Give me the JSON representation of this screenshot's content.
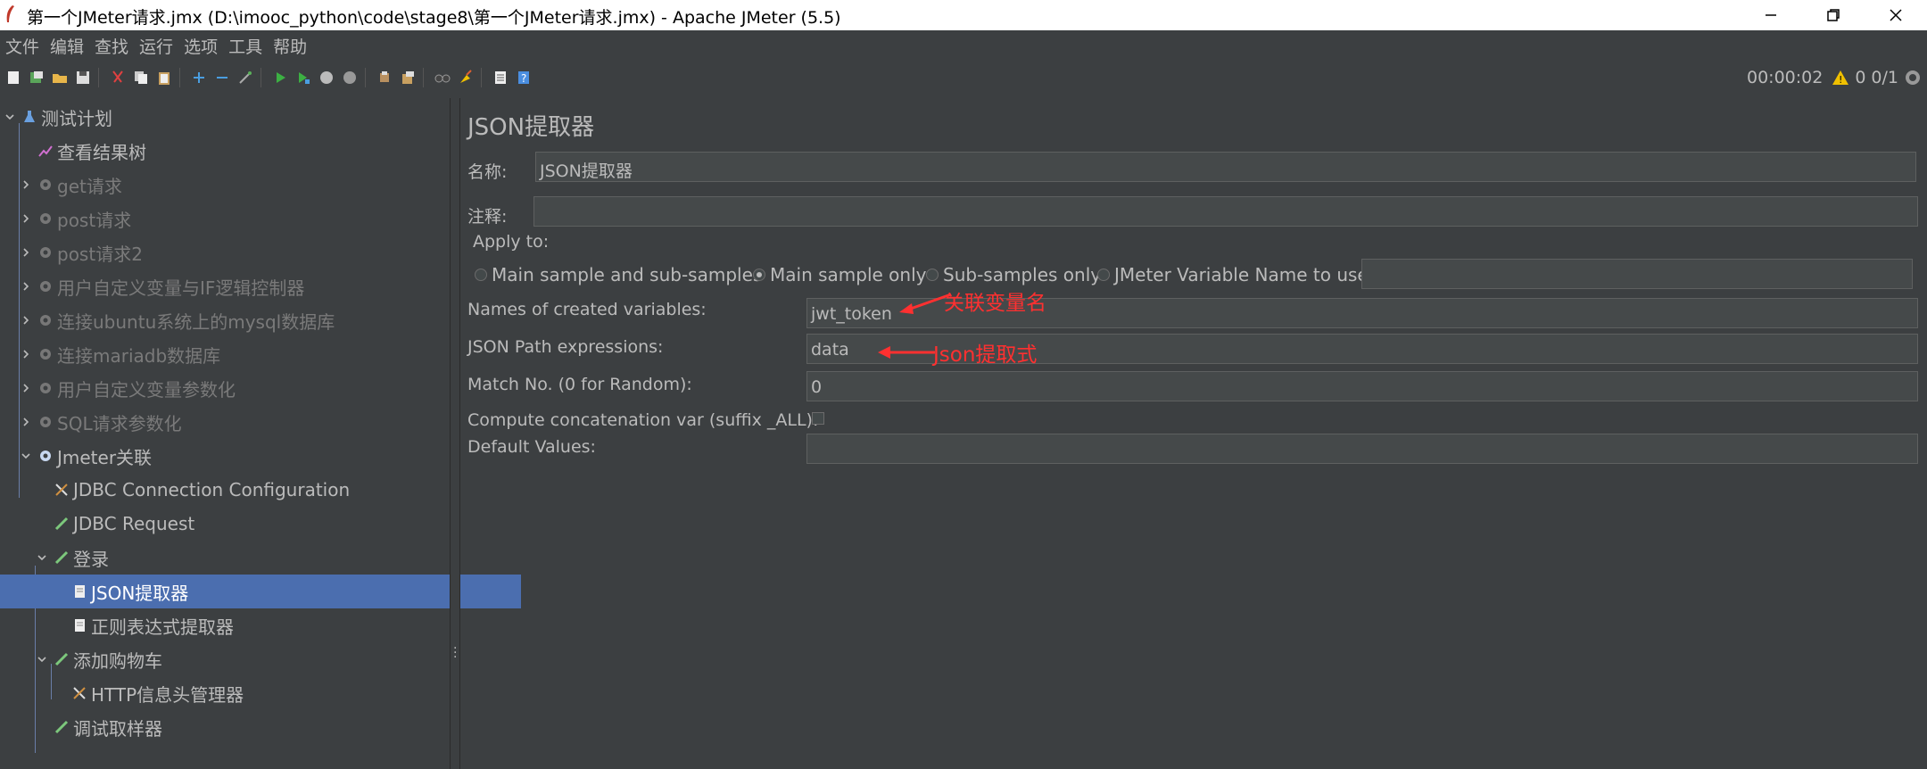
{
  "window": {
    "title": "第一个JMeter请求.jmx (D:\\imooc_python\\code\\stage8\\第一个JMeter请求.jmx) - Apache JMeter (5.5)"
  },
  "menu": [
    "文件",
    "编辑",
    "查找",
    "运行",
    "选项",
    "工具",
    "帮助"
  ],
  "status": {
    "elapsed": "00:00:02",
    "warnings": "0",
    "threads": "0/1"
  },
  "tree": [
    {
      "label": "测试计划",
      "icon": "test-plan-icon"
    },
    {
      "label": "查看结果树",
      "icon": "results-tree-icon"
    },
    {
      "label": "get请求",
      "icon": "thread-group-icon",
      "disabled": true
    },
    {
      "label": "post请求",
      "icon": "thread-group-icon",
      "disabled": true
    },
    {
      "label": "post请求2",
      "icon": "thread-group-icon",
      "disabled": true
    },
    {
      "label": "用户自定义变量与IF逻辑控制器",
      "icon": "thread-group-icon",
      "disabled": true
    },
    {
      "label": "连接ubuntu系统上的mysql数据库",
      "icon": "thread-group-icon",
      "disabled": true
    },
    {
      "label": "连接mariadb数据库",
      "icon": "thread-group-icon",
      "disabled": true
    },
    {
      "label": "用户自定义变量参数化",
      "icon": "thread-group-icon",
      "disabled": true
    },
    {
      "label": "SQL请求参数化",
      "icon": "thread-group-icon",
      "disabled": true
    },
    {
      "label": "Jmeter关联",
      "icon": "thread-group-icon"
    },
    {
      "label": "JDBC Connection Configuration",
      "icon": "config-element-icon"
    },
    {
      "label": "JDBC Request",
      "icon": "sampler-icon"
    },
    {
      "label": "登录",
      "icon": "sampler-icon"
    },
    {
      "label": "JSON提取器",
      "icon": "post-processor-icon",
      "selected": true
    },
    {
      "label": "正则表达式提取器",
      "icon": "post-processor-icon"
    },
    {
      "label": "添加购物车",
      "icon": "sampler-icon"
    },
    {
      "label": "HTTP信息头管理器",
      "icon": "config-element-icon"
    },
    {
      "label": "调试取样器",
      "icon": "sampler-icon"
    }
  ],
  "panel": {
    "title": "JSON提取器",
    "name_label": "名称:",
    "name_value": "JSON提取器",
    "comment_label": "注释:",
    "comment_value": "",
    "apply_to_label": "Apply to:",
    "apply_options": [
      "Main sample and sub-samples",
      "Main sample only",
      "Sub-samples only",
      "JMeter Variable Name to use"
    ],
    "apply_selected": "Main sample only",
    "jmeter_var_value": "",
    "names_label": "Names of created variables:",
    "names_value": "jwt_token",
    "paths_label": "JSON Path expressions:",
    "paths_value": "data",
    "match_label": "Match No. (0 for Random):",
    "match_value": "0",
    "concat_label": "Compute concatenation var (suffix _ALL):",
    "concat_checked": false,
    "default_label": "Default Values:",
    "default_value": ""
  },
  "annotations": {
    "names_note": "关联变量名",
    "paths_note": "Json提取式"
  },
  "colors": {
    "background": "#3c3f41",
    "selection": "#4b6eaf",
    "annotation": "#ff3030"
  }
}
